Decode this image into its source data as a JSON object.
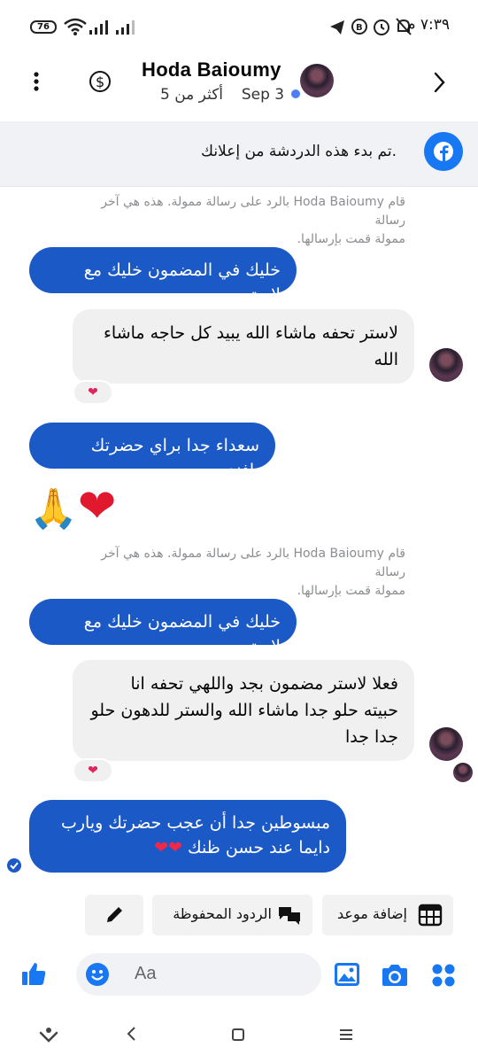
{
  "status_bar": {
    "time": "٧:٣٩ م",
    "battery": "76"
  },
  "header": {
    "contact_name": "Hoda Baioumy",
    "last_active": "Sep 3",
    "more_label": "أكثر من 5"
  },
  "banner": {
    "text": ".تم بدء هذه الدردشة من إعلانك"
  },
  "messages": {
    "sys_note_1": {
      "line1": "قام Hoda Baioumy بالرد على رسالة ممولة. هذه هي آخر رسالة",
      "line2": "ممولة قمت بإرسالها."
    },
    "out_1": "خليك في المضمون خليك مع لاستر",
    "in_1": {
      "line1": "لاستر تحفه ماشاء الله يبيد كل حاجه ماشاء",
      "line2": "الله",
      "reaction": "❤"
    },
    "out_2": "سعداء جدا براي حضرتك يافندم",
    "emoji_msg": {
      "pray": "🙏",
      "heart": "❤"
    },
    "sys_note_2": {
      "line1": "قام Hoda Baioumy بالرد على رسالة ممولة. هذه هي آخر رسالة",
      "line2": "ممولة قمت بإرسالها."
    },
    "out_3": "خليك في المضمون خليك مع لاستر",
    "in_2": {
      "line1": "فعلا لاستر مضمون بجد واللهي تحفه انا",
      "line2": "حبيته حلو جدا ماشاء الله والستر للدهون حلو",
      "line3": "جدا جدا",
      "reaction": "❤"
    },
    "out_4": {
      "line1": "مبسوطين جدا أن عجب حضرتك ويارب",
      "line2": "دايما عند حسن ظنك",
      "hearts": "❤❤"
    }
  },
  "quick_actions": {
    "add_appointment": "إضافة موعد",
    "saved_replies": "الردود المحفوظة"
  },
  "composer": {
    "placeholder": "Aa"
  },
  "colors": {
    "brand_blue": "#1877f2",
    "outgoing_bubble": "#1b59c6",
    "incoming_bubble": "#f0f0f0"
  },
  "icons": [
    "back-chevron-icon",
    "dollar-icon",
    "more-vertical-icon",
    "facebook-icon",
    "calendar-grid-icon",
    "chat-bubbles-icon",
    "pencil-icon",
    "like-icon",
    "emoji-icon",
    "image-icon",
    "camera-icon",
    "apps-icon"
  ]
}
